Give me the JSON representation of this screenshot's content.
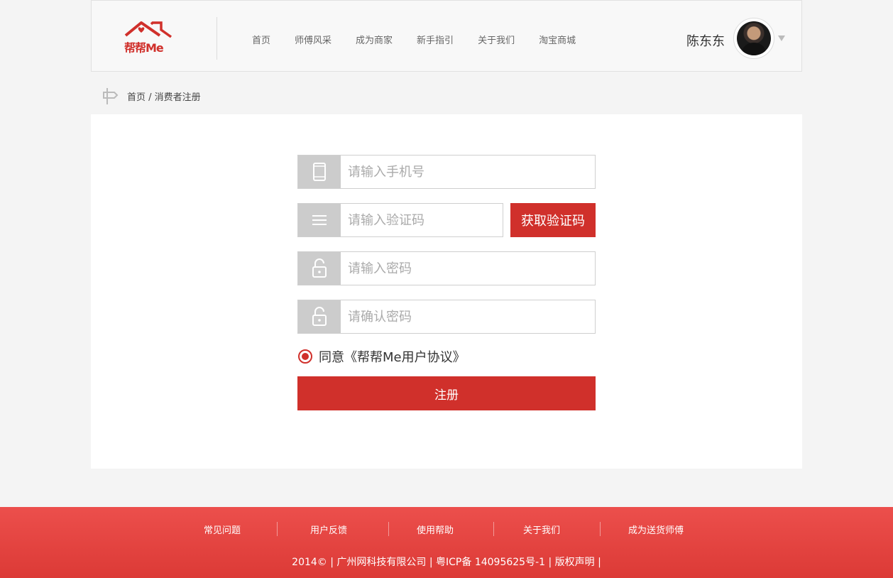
{
  "header": {
    "logo_text": "帮帮Me",
    "nav": [
      "首页",
      "师傅风采",
      "成为商家",
      "新手指引",
      "关于我们",
      "淘宝商城"
    ],
    "user_name": "陈东东"
  },
  "breadcrumb": {
    "text": "首页 / 消费者注册"
  },
  "form": {
    "phone_placeholder": "请输入手机号",
    "code_placeholder": "请输入验证码",
    "get_code_label": "获取验证码",
    "password_placeholder": "请输入密码",
    "confirm_placeholder": "请确认密码",
    "agree_text": "同意《帮帮Me用户协议》",
    "submit_label": "注册"
  },
  "footer": {
    "links": [
      "常见问题",
      "用户反馈",
      "使用帮助",
      "关于我们",
      "成为送货师傅"
    ],
    "copyright": "2014©  |  广州网科技有限公司  |  粤ICP备 14095625号-1  |  版权声明  |"
  },
  "colors": {
    "accent": "#d0302b",
    "footer": "#e4443f"
  },
  "icons": [
    "house-logo-icon",
    "phone-icon",
    "menu-icon",
    "lock-icon",
    "signpost-icon",
    "caret-down-icon"
  ]
}
